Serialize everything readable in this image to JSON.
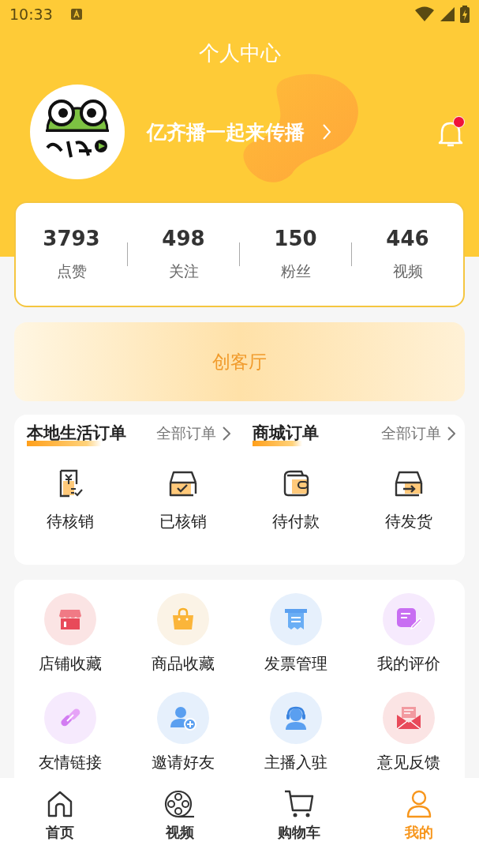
{
  "status_bar": {
    "time": "10:33"
  },
  "header": {
    "title": "个人中心",
    "username": "亿齐播一起来传播",
    "unread_notifications": true
  },
  "stats": [
    {
      "value": "3793",
      "label": "点赞"
    },
    {
      "value": "498",
      "label": "关注"
    },
    {
      "value": "150",
      "label": "粉丝"
    },
    {
      "value": "446",
      "label": "视频"
    }
  ],
  "banner": {
    "label": "创客厅"
  },
  "order_groups": [
    {
      "title": "本地生活订单",
      "link": "全部订单",
      "items": [
        {
          "label": "待核销",
          "kind": "receipt"
        },
        {
          "label": "已核销",
          "kind": "box-check"
        }
      ]
    },
    {
      "title": "商城订单",
      "link": "全部订单",
      "items": [
        {
          "label": "待付款",
          "kind": "wallet"
        },
        {
          "label": "待发货",
          "kind": "box-arrow"
        }
      ]
    }
  ],
  "services": [
    {
      "label": "店铺收藏",
      "kind": "store"
    },
    {
      "label": "商品收藏",
      "kind": "bag"
    },
    {
      "label": "发票管理",
      "kind": "invoice"
    },
    {
      "label": "我的评价",
      "kind": "review"
    },
    {
      "label": "友情链接",
      "kind": "link"
    },
    {
      "label": "邀请好友",
      "kind": "invite"
    },
    {
      "label": "主播入驻",
      "kind": "anchor"
    },
    {
      "label": "意见反馈",
      "kind": "feedback"
    }
  ],
  "tabs": [
    {
      "label": "首页",
      "kind": "home",
      "selected": false
    },
    {
      "label": "视频",
      "kind": "video",
      "selected": false
    },
    {
      "label": "购物车",
      "kind": "cart",
      "selected": false
    },
    {
      "label": "我的",
      "kind": "profile",
      "selected": true
    }
  ]
}
